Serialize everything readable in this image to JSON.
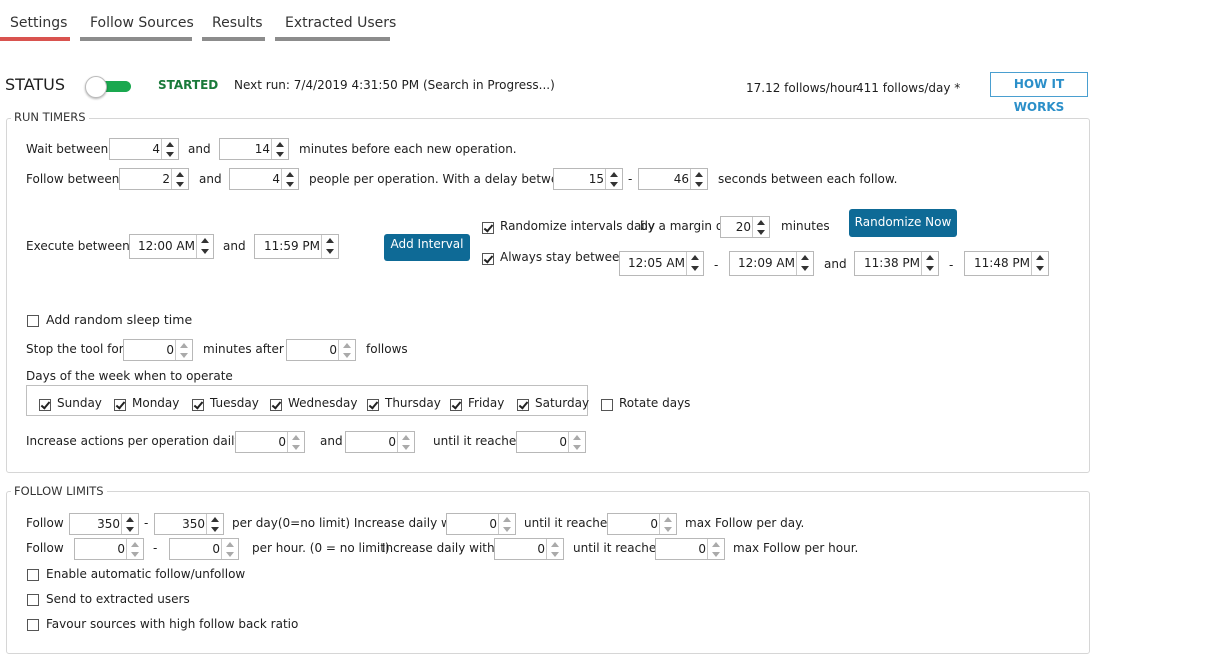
{
  "tabs": [
    {
      "label": "Settings"
    },
    {
      "label": "Follow Sources"
    },
    {
      "label": "Results"
    },
    {
      "label": "Extracted Users"
    }
  ],
  "status": {
    "label": "STATUS",
    "state": "STARTED",
    "next_run": "Next run: 7/4/2019 4:31:50 PM (Search in Progress...)",
    "follows_hour": "17.12 follows/hour",
    "follows_day": "411  follows/day *",
    "how_it_works": "HOW IT WORKS"
  },
  "run_timers": {
    "legend": "RUN TIMERS",
    "wait_label": "Wait between",
    "wait_min": "4",
    "and1": "and",
    "wait_max": "14",
    "wait_suffix": "minutes before each new operation.",
    "follow_label": "Follow between",
    "follow_min": "2",
    "and2": "and",
    "follow_max": "4",
    "follow_suffix": "people per operation.  With a delay between",
    "delay_min": "15",
    "dash1": "-",
    "delay_max": "46",
    "delay_suffix": "seconds between each follow.",
    "execute_label": "Execute between",
    "exec_start": "12:00 AM",
    "and3": "and",
    "exec_end": "11:59 PM",
    "add_interval": "Add Interval",
    "randomize_label": "Randomize intervals daily",
    "margin_label": "by a margin of",
    "margin_value": "20",
    "minutes_label": "minutes",
    "randomize_now": "Randomize Now",
    "stay_label": "Always stay between",
    "stay1": "12:05 AM",
    "dash2": "-",
    "stay2": "12:09 AM",
    "and4": "and",
    "stay3": "11:38 PM",
    "dash3": "-",
    "stay4": "11:48 PM",
    "sleep_label": "Add random sleep time",
    "stop_label": "Stop the tool for",
    "stop_value": "0",
    "minutes_after": "minutes after",
    "follows_value": "0",
    "follows_label": "follows",
    "days_title": "Days of the week when to operate",
    "days": [
      "Sunday",
      "Monday",
      "Tuesday",
      "Wednesday",
      "Thursday",
      "Friday",
      "Saturday"
    ],
    "rotate_label": "Rotate days",
    "increase_label": "Increase actions per operation daily by",
    "inc1": "0",
    "and5": "and",
    "inc2": "0",
    "until_label": "until it reaches",
    "inc3": "0"
  },
  "follow_limits": {
    "legend": "FOLLOW LIMITS",
    "row1_label": "Follow",
    "day_min": "350",
    "dash4": "-",
    "day_max": "350",
    "day_text": "per day(0=no limit)  Increase daily with",
    "day_inc": "0",
    "until1": "until it reaches",
    "day_reach": "0",
    "max_day": "max Follow per day.",
    "row2_label": "Follow",
    "hr_min": "0",
    "dash5": "-",
    "hr_max": "0",
    "hr_text": "per hour. (0 = no limit)",
    "hr_inc_label": "Increase daily with",
    "hr_inc": "0",
    "until2": "until it reaches",
    "hr_reach": "0",
    "max_hr": "max Follow per hour.",
    "auto_label": "Enable automatic follow/unfollow",
    "send_label": "Send to extracted users",
    "favour_label": "Favour sources with high follow back ratio"
  },
  "colors": {
    "accent_tab": "#d9534f",
    "started": "#1a7a3a",
    "toggle": "#1aa84f",
    "button": "#0e6a96"
  }
}
